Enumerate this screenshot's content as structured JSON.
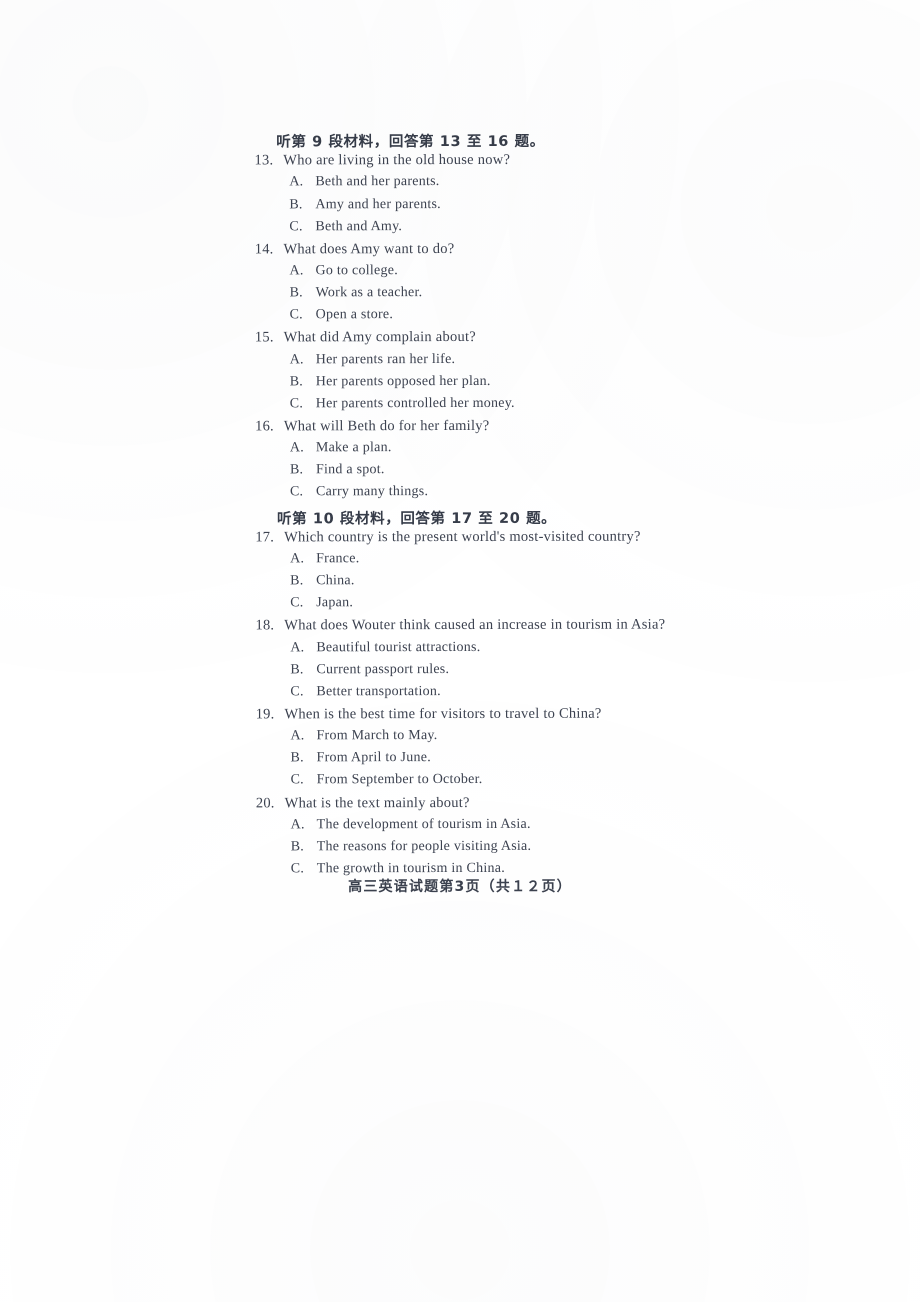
{
  "document": {
    "type": "scanned-exam-page",
    "footer": "高三英语试题第3页（共１２页）"
  },
  "sections": [
    {
      "heading": "听第 9 段材料，回答第 13 至 16 题。",
      "questions": [
        {
          "number": "13.",
          "text": "Who are living in the old house now?",
          "options": [
            {
              "letter": "A.",
              "text": "Beth and her parents."
            },
            {
              "letter": "B.",
              "text": "Amy and her parents."
            },
            {
              "letter": "C.",
              "text": "Beth and Amy."
            }
          ]
        },
        {
          "number": "14.",
          "text": "What does Amy want to do?",
          "options": [
            {
              "letter": "A.",
              "text": "Go to college."
            },
            {
              "letter": "B.",
              "text": "Work as a teacher."
            },
            {
              "letter": "C.",
              "text": "Open a store."
            }
          ]
        },
        {
          "number": "15.",
          "text": "What did Amy complain about?",
          "options": [
            {
              "letter": "A.",
              "text": "Her parents ran her life."
            },
            {
              "letter": "B.",
              "text": "Her parents opposed her plan."
            },
            {
              "letter": "C.",
              "text": "Her parents controlled her money."
            }
          ]
        },
        {
          "number": "16.",
          "text": "What will Beth do for her family?",
          "options": [
            {
              "letter": "A.",
              "text": "Make a plan."
            },
            {
              "letter": "B.",
              "text": "Find a spot."
            },
            {
              "letter": "C.",
              "text": "Carry many things."
            }
          ]
        }
      ]
    },
    {
      "heading": "听第 10 段材料，回答第 17 至 20 题。",
      "questions": [
        {
          "number": "17.",
          "text": "Which country is the present world's most-visited country?",
          "options": [
            {
              "letter": "A.",
              "text": "France."
            },
            {
              "letter": "B.",
              "text": "China."
            },
            {
              "letter": "C.",
              "text": "Japan."
            }
          ]
        },
        {
          "number": "18.",
          "text": "What does Wouter think caused an increase in tourism in Asia?",
          "options": [
            {
              "letter": "A.",
              "text": "Beautiful tourist attractions."
            },
            {
              "letter": "B.",
              "text": "Current passport rules."
            },
            {
              "letter": "C.",
              "text": "Better transportation."
            }
          ]
        },
        {
          "number": "19.",
          "text": "When is the best time for visitors to travel to China?",
          "options": [
            {
              "letter": "A.",
              "text": "From March to May."
            },
            {
              "letter": "B.",
              "text": "From April to June."
            },
            {
              "letter": "C.",
              "text": "From September to October."
            }
          ]
        },
        {
          "number": "20.",
          "text": "What is the text mainly about?",
          "options": [
            {
              "letter": "A.",
              "text": "The development of tourism in Asia."
            },
            {
              "letter": "B.",
              "text": "The reasons for people visiting Asia."
            },
            {
              "letter": "C.",
              "text": "The growth in tourism in China."
            }
          ]
        }
      ]
    }
  ]
}
